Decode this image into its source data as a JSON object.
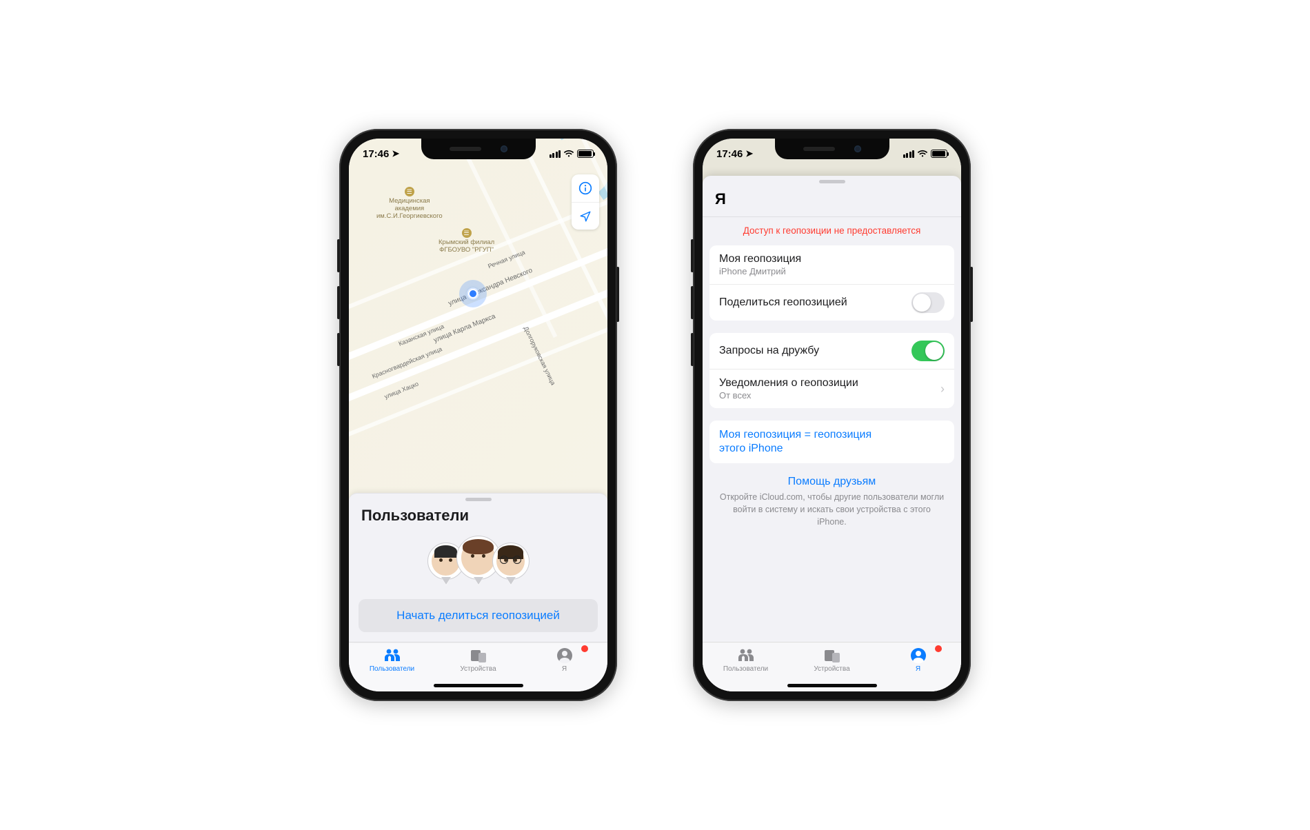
{
  "status": {
    "time": "17:46"
  },
  "left": {
    "map": {
      "poi1": {
        "title": "Медицинская\nакадемия\nим.С.И.Георгиевского"
      },
      "poi2": {
        "title": "Крымский филиал\nФГБОУВО \"РГУП\""
      },
      "streets": {
        "s1": "улица Александра Невского",
        "s2": "улица Карла Маркса",
        "s3": "Речная улица",
        "s4": "Долгоруковская улица",
        "s5": "Казанская улица",
        "s6": "Красногвардейская улица",
        "s7": "улица Хацко"
      }
    },
    "sheet": {
      "title": "Пользователи",
      "start_sharing": "Начать делиться геопозицией"
    },
    "tabs": {
      "people": "Пользователи",
      "devices": "Устройства",
      "me": "Я"
    }
  },
  "right": {
    "title": "Я",
    "warning": "Доступ к геопозиции не предоставляется",
    "group1": {
      "my_location_label": "Моя геопозиция",
      "my_location_sub": "iPhone Дмитрий",
      "share_label": "Поделиться геопозицией",
      "share_on": false
    },
    "group2": {
      "friend_req_label": "Запросы на дружбу",
      "friend_req_on": true,
      "notif_label": "Уведомления о геопозиции",
      "notif_sub": "От всех"
    },
    "group3": {
      "link_text": "Моя геопозиция = геопозиция этого iPhone"
    },
    "help": {
      "link": "Помощь друзьям",
      "desc": "Откройте iCloud.com, чтобы другие пользователи могли войти в систему и искать свои устройства с этого iPhone."
    },
    "tabs": {
      "people": "Пользователи",
      "devices": "Устройства",
      "me": "Я"
    }
  }
}
